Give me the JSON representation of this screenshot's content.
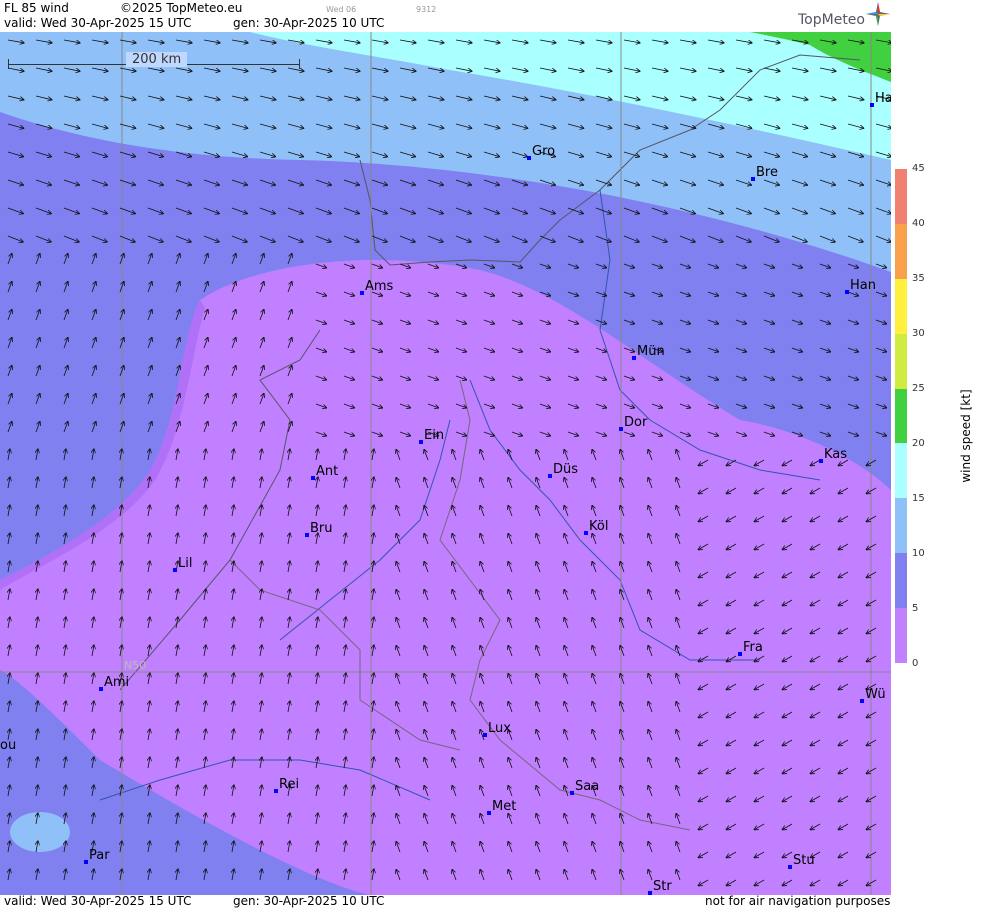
{
  "header": {
    "product": "FL 85 wind",
    "copyright": "©2025 TopMeteo.eu",
    "daycode": "Wed 06",
    "code": "9312",
    "valid": "valid:  Wed  30-Apr-2025  15 UTC",
    "generated": "gen: 30-Apr-2025 10 UTC"
  },
  "logo": {
    "text": "TopMeteo"
  },
  "scale": {
    "label": "200 km"
  },
  "graticule": {
    "lat_label": "N50"
  },
  "legend": {
    "title": "wind  speed  [kt]",
    "ticks": [
      "45",
      "40",
      "35",
      "30",
      "25",
      "20",
      "15",
      "10",
      "5",
      "0"
    ],
    "colors": [
      "#f08070",
      "#f9a04a",
      "#fff040",
      "#d0ec40",
      "#40d040",
      "#aaffff",
      "#90c0f8",
      "#8080f0",
      "#c080ff"
    ]
  },
  "cities": [
    {
      "name": "Gro"
    },
    {
      "name": "Bre"
    },
    {
      "name": "Ha"
    },
    {
      "name": "Ams"
    },
    {
      "name": "Han"
    },
    {
      "name": "Mün"
    },
    {
      "name": "Dor"
    },
    {
      "name": "Ein"
    },
    {
      "name": "Kas"
    },
    {
      "name": "Ant"
    },
    {
      "name": "Düs"
    },
    {
      "name": "Bru"
    },
    {
      "name": "Köl"
    },
    {
      "name": "Lil"
    },
    {
      "name": "Fra"
    },
    {
      "name": "Ami"
    },
    {
      "name": "Wü"
    },
    {
      "name": "Lux"
    },
    {
      "name": "Rei"
    },
    {
      "name": "Saa"
    },
    {
      "name": "Met"
    },
    {
      "name": "Par"
    },
    {
      "name": "Stu"
    },
    {
      "name": "Str"
    },
    {
      "name": "ou"
    }
  ],
  "footer": {
    "valid": "valid:  Wed  30-Apr-2025  15 UTC",
    "generated": "gen: 30-Apr-2025 10 UTC",
    "disclaimer": "not for air navigation purposes"
  }
}
